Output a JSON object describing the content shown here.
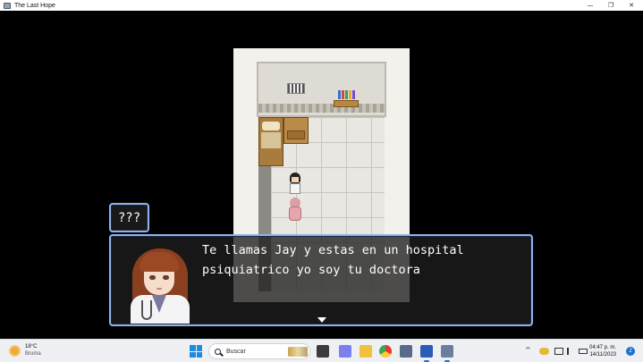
{
  "window": {
    "title": "The Last Hope",
    "minimize_glyph": "—",
    "maximize_glyph": "❐",
    "close_glyph": "✕"
  },
  "dialog": {
    "speaker": "???",
    "lines": [
      "Te llamas Jay y estas en un hospital",
      "psiquiatrico yo soy tu doctora"
    ],
    "continue_icon": "down-arrow-icon",
    "portrait": "doctor-portrait"
  },
  "map": {
    "characters": [
      "jay-sprite",
      "doctor-sprite"
    ],
    "book_colors": [
      "#3a6fd0",
      "#d04a3a",
      "#3aa05a",
      "#e0b030",
      "#7a4ad0"
    ]
  },
  "taskbar": {
    "weather": {
      "temp": "18°C",
      "condition": "Bruma"
    },
    "search_placeholder": "Buscar",
    "clock": {
      "time": "04:47 p. m.",
      "date": "14/11/2023"
    },
    "notification_count": "2",
    "tray_chevron": "^",
    "pinned_icons": [
      "start-icon",
      "search-icon",
      "task-view-icon",
      "file-explorer-icon",
      "chrome-icon",
      "store-icon",
      "word-icon",
      "game-icon"
    ]
  }
}
